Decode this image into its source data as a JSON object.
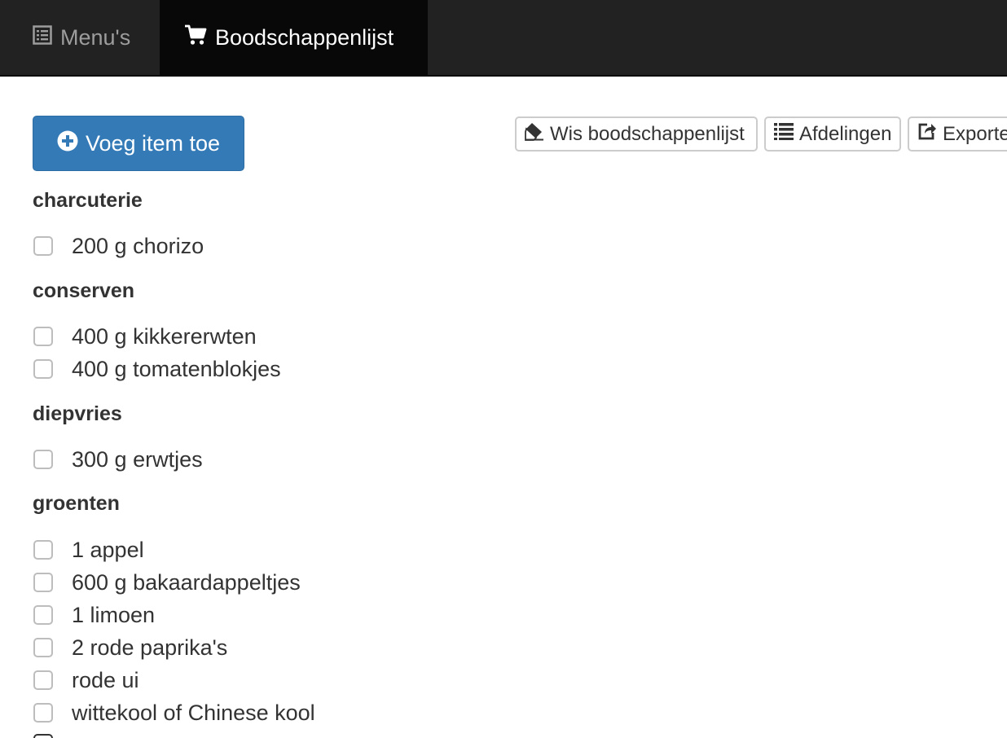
{
  "nav": {
    "menus_label": "Menu's",
    "list_label": "Boodschappenlijst"
  },
  "toolbar": {
    "add_label": "Voeg item toe",
    "clear_label": "Wis boodschappenlijst",
    "departments_label": "Afdelingen",
    "export_label": "Exporteer"
  },
  "sections": [
    {
      "title": "charcuterie",
      "items": [
        "200 g chorizo"
      ]
    },
    {
      "title": "conserven",
      "items": [
        "400 g kikkererwten",
        "400 g tomatenblokjes"
      ]
    },
    {
      "title": "diepvries",
      "items": [
        "300 g erwtjes"
      ]
    },
    {
      "title": "groenten",
      "items": [
        "1 appel",
        "600 g bakaardappeltjes",
        "1 limoen",
        "2 rode paprika's",
        "rode ui",
        "wittekool of Chinese kool"
      ]
    }
  ],
  "icons": {
    "menus": "list-alt-icon",
    "list": "shopping-cart-icon",
    "add": "plus-circle-icon",
    "clear": "eraser-icon",
    "departments": "list-icon",
    "export": "share-icon"
  },
  "colors": {
    "navbar": "#222222",
    "active_tab": "#080808",
    "primary": "#337ab7"
  }
}
